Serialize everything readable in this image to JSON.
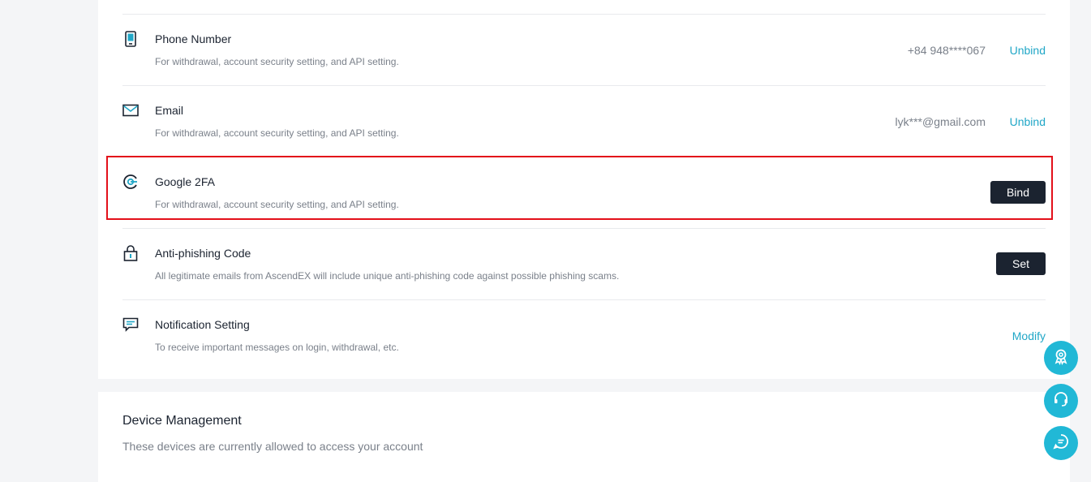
{
  "security": {
    "rows": [
      {
        "title": "Phone Number",
        "desc": "For withdrawal, account security setting, and API setting.",
        "value": "+84 948****067",
        "action": "Unbind",
        "icon": "phone-icon"
      },
      {
        "title": "Email",
        "desc": "For withdrawal, account security setting, and API setting.",
        "value": "lyk***@gmail.com",
        "action": "Unbind",
        "icon": "mail-icon"
      },
      {
        "title": "Google 2FA",
        "desc": "For withdrawal, account security setting, and API setting.",
        "action": "Bind",
        "icon": "google-icon"
      },
      {
        "title": "Anti-phishing Code",
        "desc": "All legitimate emails from AscendEX will include unique anti-phishing code against possible phishing scams.",
        "action": "Set",
        "icon": "lock-icon"
      },
      {
        "title": "Notification Setting",
        "desc": "To receive important messages on login, withdrawal, etc.",
        "action": "Modify",
        "icon": "message-icon"
      }
    ]
  },
  "device": {
    "title": "Device Management",
    "desc": "These devices are currently allowed to access your account"
  },
  "floating": [
    "rewards-icon",
    "support-headset-icon",
    "chat-icon"
  ],
  "colors": {
    "accent": "#21a7c7",
    "dark_button": "#1b2330",
    "highlight": "#e3101a",
    "float_bg": "#21b8d6"
  }
}
